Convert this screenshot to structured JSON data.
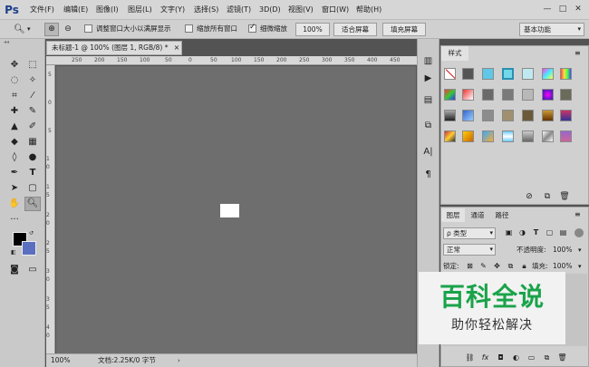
{
  "app": {
    "logo": "Ps"
  },
  "menu": [
    "文件(F)",
    "编辑(E)",
    "图像(I)",
    "图层(L)",
    "文字(Y)",
    "选择(S)",
    "滤镜(T)",
    "3D(D)",
    "视图(V)",
    "窗口(W)",
    "帮助(H)"
  ],
  "window_controls": [
    "—",
    "□",
    "✕"
  ],
  "options": {
    "resize_windows_label": "调整窗口大小以满屏显示",
    "zoom_all_label": "缩放所有窗口",
    "scrubby_zoom_label": "细微缩放",
    "zoom_percent_btn": "100%",
    "fit_screen_btn": "适合屏幕",
    "fill_screen_btn": "填充屏幕",
    "workspace": "基本功能"
  },
  "document": {
    "tab_title": "未标题-1 @ 100% (图层 1, RGB/8) *",
    "close": "×",
    "ruler_h": [
      "250",
      "200",
      "150",
      "100",
      "50",
      "0",
      "50",
      "100",
      "150",
      "200",
      "250",
      "300",
      "350",
      "400",
      "450"
    ],
    "ruler_v": [
      "5",
      "0",
      "5",
      "1 0",
      "1 5",
      "2 0",
      "2 5",
      "3 0",
      "3 5",
      "4 0"
    ],
    "status_zoom": "100%",
    "status_doc": "文档:2.25K/0 字节"
  },
  "styles_panel": {
    "tab": "样式"
  },
  "layers_panel": {
    "tabs": [
      "图层",
      "通道",
      "路径"
    ],
    "kind_label": "ρ 类型",
    "blend_mode": "正常",
    "opacity_label": "不透明度:",
    "opacity_value": "100%",
    "lock_label": "锁定:",
    "fill_label": "填充:",
    "fill_value": "100%"
  },
  "watermark": {
    "title": "百科全说",
    "subtitle": "助你轻松解决"
  },
  "colors": {
    "accent_green": "#1aa34a",
    "foreground": "#000000",
    "background": "#5b6fc0"
  }
}
